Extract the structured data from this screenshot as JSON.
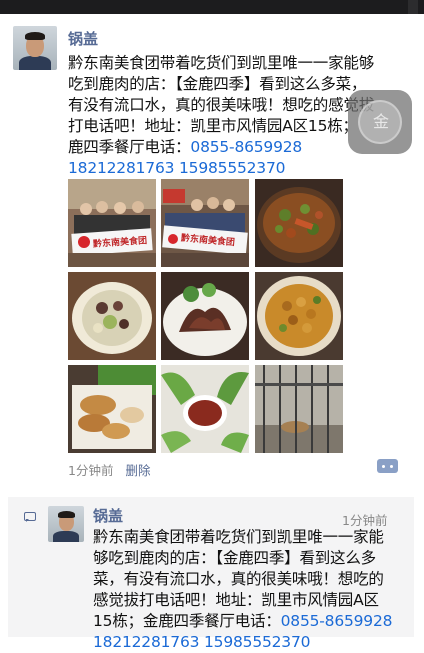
{
  "post": {
    "author": "锅盖",
    "lines": [
      "黔东南美食团带着吃货们到凯里唯一一家能够",
      "吃到鹿肉的店：【金鹿四季】看到这么多菜，",
      "有没有流口水，真的很美味哦！想吃的感觉拔",
      "打电话吧！地址：凯里市风情园A区15栋；"
    ],
    "line5_prefix": "鹿四季餐厅电话：",
    "phone1": "0855-8659928",
    "phone2": "18212281763",
    "phone3": "15985552370",
    "time": "1分钟前",
    "delete_label": "删除",
    "photos": [
      {
        "icon": "group-banner-photo",
        "banner": "黔东南美食团"
      },
      {
        "icon": "group-banner-photo-2",
        "banner": "黔东南美食团"
      },
      {
        "icon": "stew-pot-photo"
      },
      {
        "icon": "plated-dish-photo"
      },
      {
        "icon": "mushroom-dish-photo"
      },
      {
        "icon": "beans-dish-photo"
      },
      {
        "icon": "fried-food-photo"
      },
      {
        "icon": "greens-dip-photo"
      },
      {
        "icon": "deer-cage-photo"
      }
    ]
  },
  "floating_button": {
    "glyph": "金"
  },
  "repost": {
    "author": "锅盖",
    "time": "1分钟前",
    "lines": [
      "黔东南美食团带着吃货们到凯里唯一一家能",
      "够吃到鹿肉的店：【金鹿四季】看到这么多",
      "菜，有没有流口水，真的很美味哦！想吃的",
      "感觉拔打电话吧！地址：凯里市风情园A区"
    ],
    "line5_prefix": "15栋；金鹿四季餐厅电话：",
    "phone1": "0855-8659928",
    "phone2": "18212281763",
    "phone3": "15985552370"
  },
  "colors": {
    "name": "#576b95",
    "link": "#1b6ad6",
    "card": "#f4f4f5"
  }
}
